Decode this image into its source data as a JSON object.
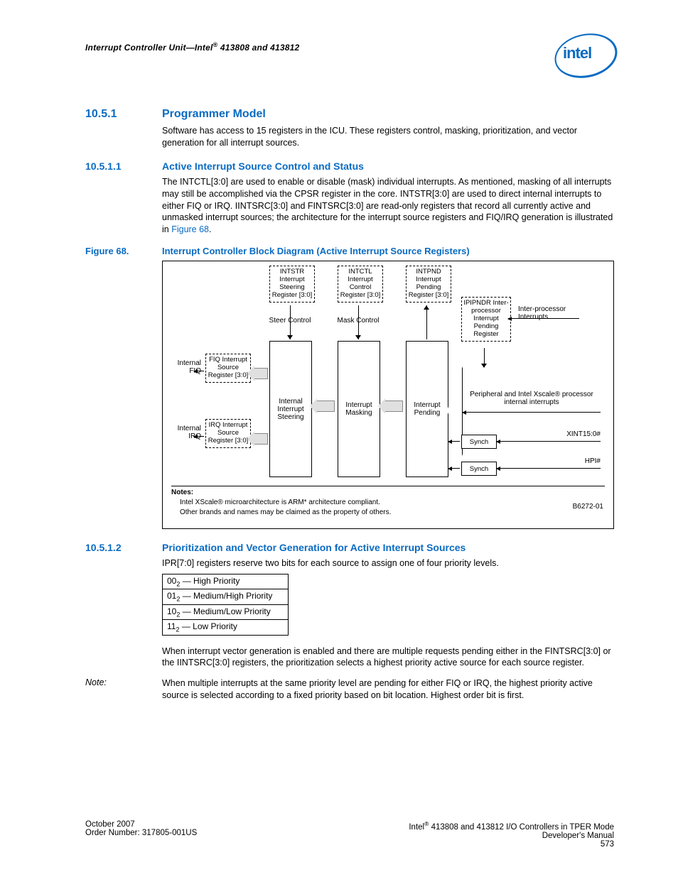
{
  "header": {
    "running_title": "Interrupt Controller Unit—Intel® 413808 and 413812",
    "logo_text": "intel"
  },
  "section_10_5_1": {
    "number": "10.5.1",
    "title": "Programmer Model",
    "para1": "Software has access to 15 registers in the ICU. These registers control, masking, prioritization, and vector generation for all interrupt sources."
  },
  "section_10_5_1_1": {
    "number": "10.5.1.1",
    "title": "Active Interrupt Source Control and Status",
    "para1_a": "The INTCTL[3:0] are used to enable or disable (mask) individual interrupts. As mentioned, masking of all interrupts may still be accomplished via the CPSR register in the core. INTSTR[3:0] are used to direct internal interrupts to either FIQ or IRQ. IINTSRC[3:0] and FINTSRC[3:0] are read-only registers that record all currently active and unmasked interrupt sources; the architecture for the interrupt source registers and FIQ/IRQ generation is illustrated in ",
    "figref": "Figure 68",
    "para1_b": "."
  },
  "figure68": {
    "label_num": "Figure 68.",
    "caption": "Interrupt Controller Block Diagram (Active Interrupt Source Registers)",
    "boxes": {
      "intstr": "INTSTR Interrupt Steering Register [3:0]",
      "intctl": "INTCTL Interrupt Control Register [3:0]",
      "intpnd": "INTPND Interrupt Pending Register [3:0]",
      "ipipndr": "IPIPNDR Inter-processor Interrupt Pending Register",
      "fiq_src": "FIQ Interrupt Source Register [3:0]",
      "irq_src": "IRQ Interrupt Source Register [3:0]",
      "steering": "Internal Interrupt Steering",
      "masking": "Interrupt Masking",
      "pending": "Interrupt Pending",
      "synch1": "Synch",
      "synch2": "Synch"
    },
    "labels": {
      "steer_control": "Steer Control",
      "mask_control": "Mask Control",
      "internal_fiq": "Internal FIQ",
      "internal_irq": "Internal IRQ",
      "ipi": "Inter-processor Interrupts",
      "periph": "Peripheral and Intel Xscale® processor internal interrupts",
      "xint": "XINT15:0#",
      "hpi": "HPI#"
    },
    "notes_header": "Notes:",
    "note1": "Intel XScale® microarchitecture is ARM* architecture compliant.",
    "note2": "Other brands and names may be claimed as the property of others.",
    "diagram_id": "B6272-01"
  },
  "section_10_5_1_2": {
    "number": "10.5.1.2",
    "title": "Prioritization and Vector Generation for Active Interrupt Sources",
    "para1": "IPR[7:0] registers reserve two bits for each source to assign one of four priority levels.",
    "table": [
      {
        "code": "00",
        "sub": "2",
        "label": " — High Priority"
      },
      {
        "code": "01",
        "sub": "2",
        "label": " — Medium/High Priority"
      },
      {
        "code": "10",
        "sub": "2",
        "label": " — Medium/Low Priority"
      },
      {
        "code": "11",
        "sub": "2",
        "label": " — Low Priority"
      }
    ],
    "para2": "When interrupt vector generation is enabled and there are multiple requests pending either in the FINTSRC[3:0] or the IINTSRC[3:0] registers, the prioritization selects a highest priority active source for each source register.",
    "note_label": "Note:",
    "note_body": "When multiple interrupts at the same priority level are pending for either FIQ or IRQ, the highest priority active source is selected according to a fixed priority based on bit location. Highest order bit is first."
  },
  "footer": {
    "left1": "October 2007",
    "left2": "Order Number: 317805-001US",
    "right1": "Intel® 413808 and 413812 I/O Controllers in TPER Mode",
    "right2": "Developer's Manual",
    "right3": "573"
  }
}
